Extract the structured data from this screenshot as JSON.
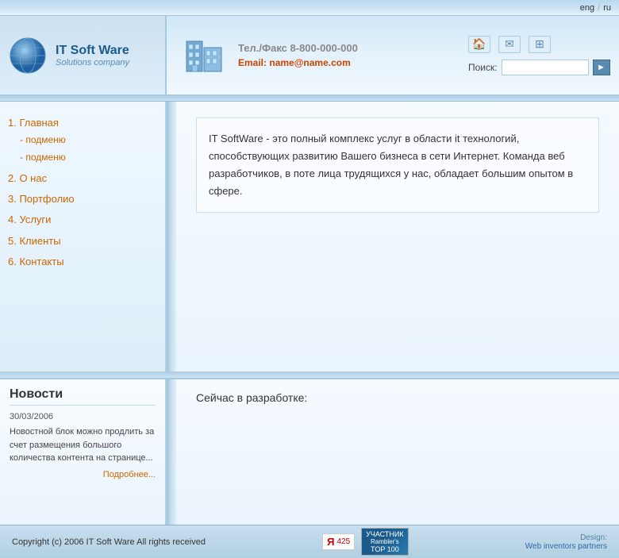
{
  "topbar": {
    "lang_eng": "eng",
    "lang_sep": "/",
    "lang_ru": "ru"
  },
  "header": {
    "logo_title": "IT Soft Ware",
    "logo_subtitle": "Solutions company",
    "phone_label": "Тел./Факс 8-800-000-000",
    "email_label": "Email:",
    "email_value": "name@name.com",
    "search_label": "Поиск:",
    "search_placeholder": "",
    "search_go": "►"
  },
  "nav": {
    "items": [
      {
        "label": "1. Главная",
        "sub": [
          "- подменю",
          "- подменю"
        ]
      },
      {
        "label": "2. О нас",
        "sub": []
      },
      {
        "label": "3. Портфолио",
        "sub": []
      },
      {
        "label": "4. Услуги",
        "sub": []
      },
      {
        "label": "5. Клиенты",
        "sub": []
      },
      {
        "label": "6. Контакты",
        "sub": []
      }
    ]
  },
  "content": {
    "main_text": "IT SoftWare - это полный комплекс услуг в области it технологий, способствующих развитию Вашего бизнеса в сети Интернет. Команда веб разработчиков, в поте лица трудящихся у нас, обладает большим опытом в сфере."
  },
  "news": {
    "title": "Новости",
    "date": "30/03/2006",
    "text": "Новостной блок можно продлить за счет размещения большого количества контента на странице...",
    "more_label": "Подробнее..."
  },
  "dev": {
    "title": "Сейчас в разработке:"
  },
  "footer": {
    "copyright": "Copyright (c) 2006  IT Soft Ware All rights received",
    "yandex_num": "425",
    "rambler_label": "УЧАСТНИК",
    "top100_label": "TOP 100",
    "rambler_name": "Rambler's",
    "design_label": "Design:",
    "design_link": "Web inventors partners"
  }
}
